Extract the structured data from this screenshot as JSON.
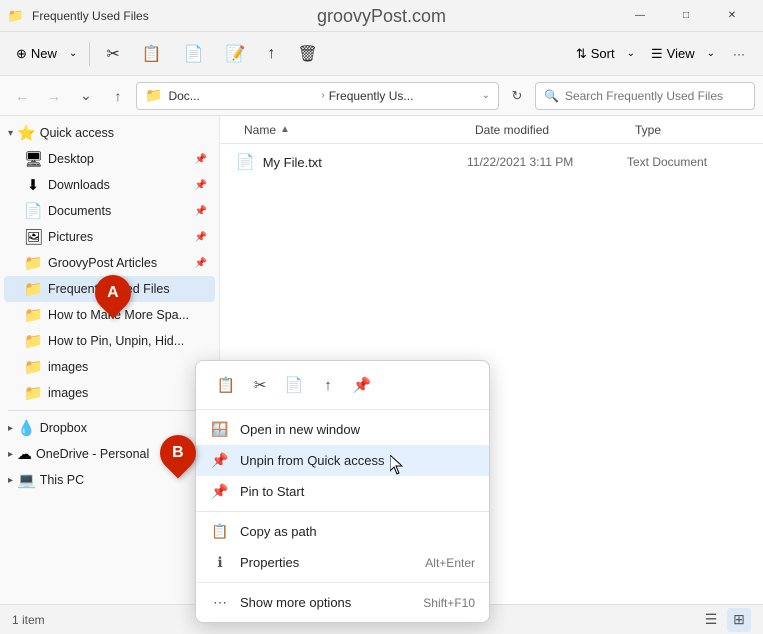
{
  "window": {
    "title": "Frequently Used Files",
    "watermark": "groovyPost.com",
    "controls": {
      "minimize": "—",
      "maximize": "□",
      "close": "✕"
    }
  },
  "toolbar": {
    "new_label": "New",
    "cut_label": "",
    "copy_label": "",
    "paste_label": "",
    "rename_label": "",
    "share_label": "",
    "delete_label": "",
    "sort_label": "Sort",
    "view_label": "View",
    "more_label": "···"
  },
  "addressbar": {
    "back_btn": "←",
    "forward_btn": "→",
    "recent_btn": "⌄",
    "up_btn": "↑",
    "path_icon": "📁",
    "path_part1": "Doc...",
    "path_sep": "›",
    "path_part2": "Frequently Us...",
    "path_dropdown": "⌄",
    "refresh": "↻",
    "search_placeholder": "Search Frequently Used Files"
  },
  "sidebar": {
    "quick_access_label": "Quick access",
    "items": [
      {
        "label": "Desktop",
        "icon": "🖥",
        "pin": true
      },
      {
        "label": "Downloads",
        "icon": "⬇",
        "pin": true
      },
      {
        "label": "Documents",
        "icon": "📄",
        "pin": true
      },
      {
        "label": "Pictures",
        "icon": "🖼",
        "pin": true
      },
      {
        "label": "GroovyPost Articles",
        "icon": "📁",
        "pin": true
      },
      {
        "label": "Frequently Used Files",
        "icon": "📁",
        "pin": false,
        "selected": true
      },
      {
        "label": "How to Make More Spa...",
        "icon": "📁",
        "pin": false
      },
      {
        "label": "How to Pin, Unpin, Hid...",
        "icon": "📁",
        "pin": false
      },
      {
        "label": "images",
        "icon": "📁",
        "pin": false
      },
      {
        "label": "images",
        "icon": "📁",
        "pin": false
      }
    ],
    "dropbox_label": "Dropbox",
    "onedrive_label": "OneDrive - Personal",
    "thispc_label": "This PC"
  },
  "file_list": {
    "col_name": "Name",
    "col_date": "Date modified",
    "col_type": "Type",
    "files": [
      {
        "name": "My File.txt",
        "icon": "📄",
        "date": "11/22/2021 3:11 PM",
        "type": "Text Document"
      }
    ]
  },
  "context_menu": {
    "top_icons": [
      "📋",
      "✂",
      "📄",
      "🔗",
      "📌"
    ],
    "items": [
      {
        "icon": "🪟",
        "label": "Open in new window",
        "shortcut": "",
        "highlighted": false
      },
      {
        "icon": "📌",
        "label": "Unpin from Quick access",
        "shortcut": "",
        "highlighted": true
      },
      {
        "icon": "📌",
        "label": "Pin to Start",
        "shortcut": "",
        "highlighted": false
      },
      {
        "icon": "📋",
        "label": "Copy as path",
        "shortcut": "",
        "highlighted": false
      },
      {
        "icon": "ℹ",
        "label": "Properties",
        "shortcut": "Alt+Enter",
        "highlighted": false
      },
      {
        "icon": "⋯",
        "label": "Show more options",
        "shortcut": "Shift+F10",
        "highlighted": false
      }
    ]
  },
  "statusbar": {
    "count": "1 item"
  },
  "badges": {
    "a_label": "A",
    "b_label": "B"
  }
}
